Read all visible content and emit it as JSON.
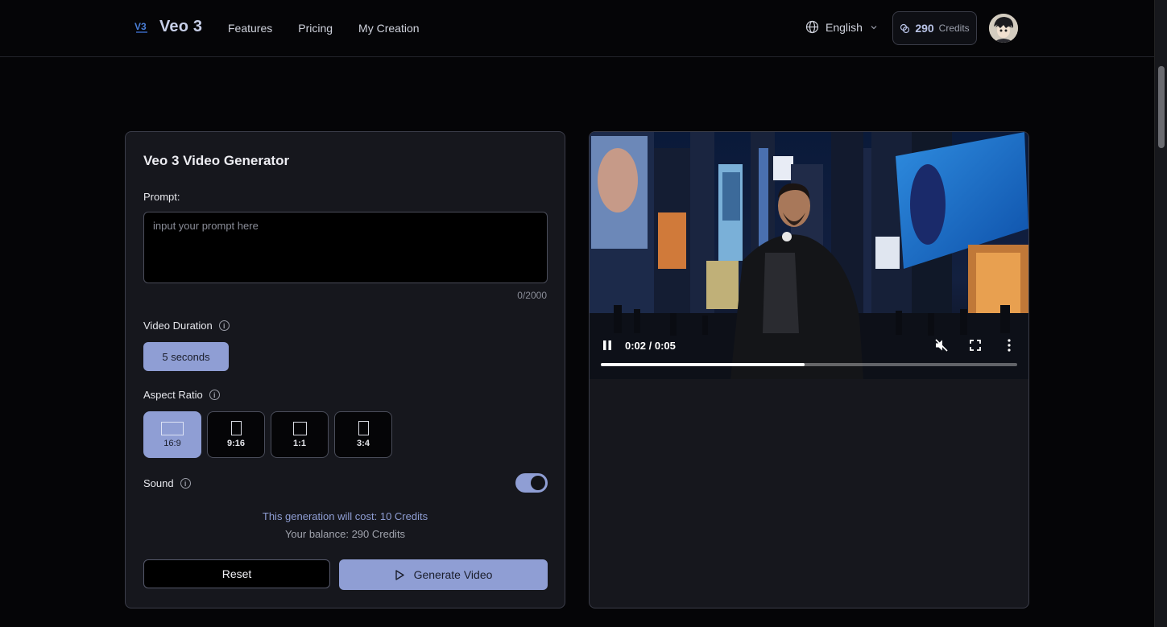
{
  "header": {
    "logo_text": "Veo 3",
    "nav": [
      "Features",
      "Pricing",
      "My Creation"
    ],
    "language": "English",
    "credits_value": "290",
    "credits_label": "Credits"
  },
  "generator": {
    "title": "Veo 3 Video Generator",
    "prompt_label": "Prompt:",
    "prompt_placeholder": "input your prompt here",
    "prompt_value": "",
    "char_counter": "0/2000",
    "duration_label": "Video Duration",
    "duration_option": "5 seconds",
    "aspect_label": "Aspect Ratio",
    "aspect_ratios": [
      "16:9",
      "9:16",
      "1:1",
      "3:4"
    ],
    "aspect_selected": "16:9",
    "sound_label": "Sound",
    "sound_on": true,
    "cost_text": "This generation will cost: 10 Credits",
    "balance_text": "Your balance: 290 Credits",
    "reset_label": "Reset",
    "generate_label": "Generate Video"
  },
  "video": {
    "time_display": "0:02 / 0:05",
    "progress_fraction": 0.49,
    "muted": true
  },
  "colors": {
    "accent": "#8f9ed4",
    "background": "#050507",
    "panel": "#16171d"
  }
}
